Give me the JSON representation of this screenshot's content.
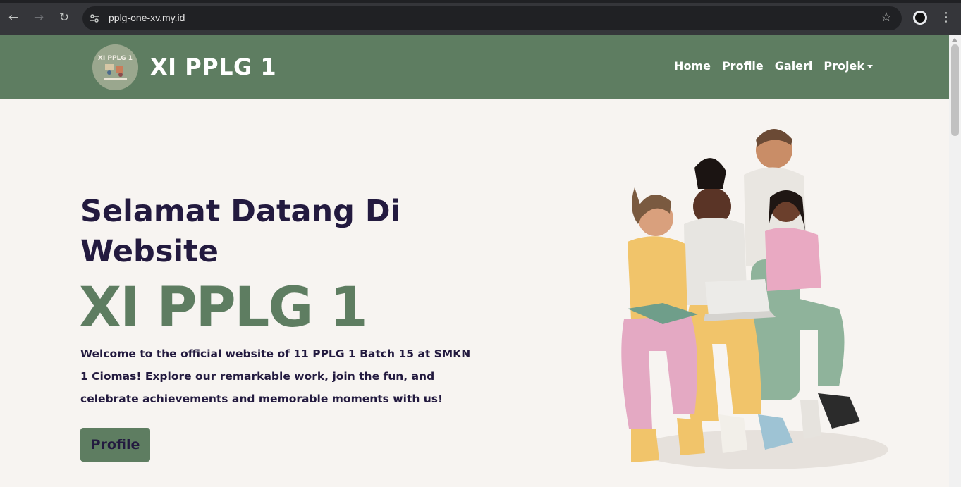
{
  "browser": {
    "url": "pplg-one-xv.my.id",
    "icons": [
      "back-arrow-icon",
      "forward-arrow-icon",
      "reload-icon",
      "site-settings-icon",
      "bookmark-star-icon",
      "profile-avatar-icon",
      "more-options-icon"
    ]
  },
  "navbar": {
    "brand": "XI PPLG 1",
    "logo_text": "XI PPLG 1",
    "links": [
      {
        "label": "Home"
      },
      {
        "label": "Profile"
      },
      {
        "label": "Galeri"
      },
      {
        "label": "Projek"
      }
    ]
  },
  "hero": {
    "heading": "Selamat Datang Di Website",
    "title": "XI PPLG 1",
    "description": "Welcome to the official website of 11 PPLG 1 Batch 15 at SMKN 1 Ciomas! Explore our remarkable work, join the fun, and celebrate achievements and memorable moments with us!",
    "button_label": "Profile"
  },
  "colors": {
    "brand_green": "#5e7d61",
    "text_dark": "#231a3f",
    "page_bg": "#f7f4f1"
  }
}
